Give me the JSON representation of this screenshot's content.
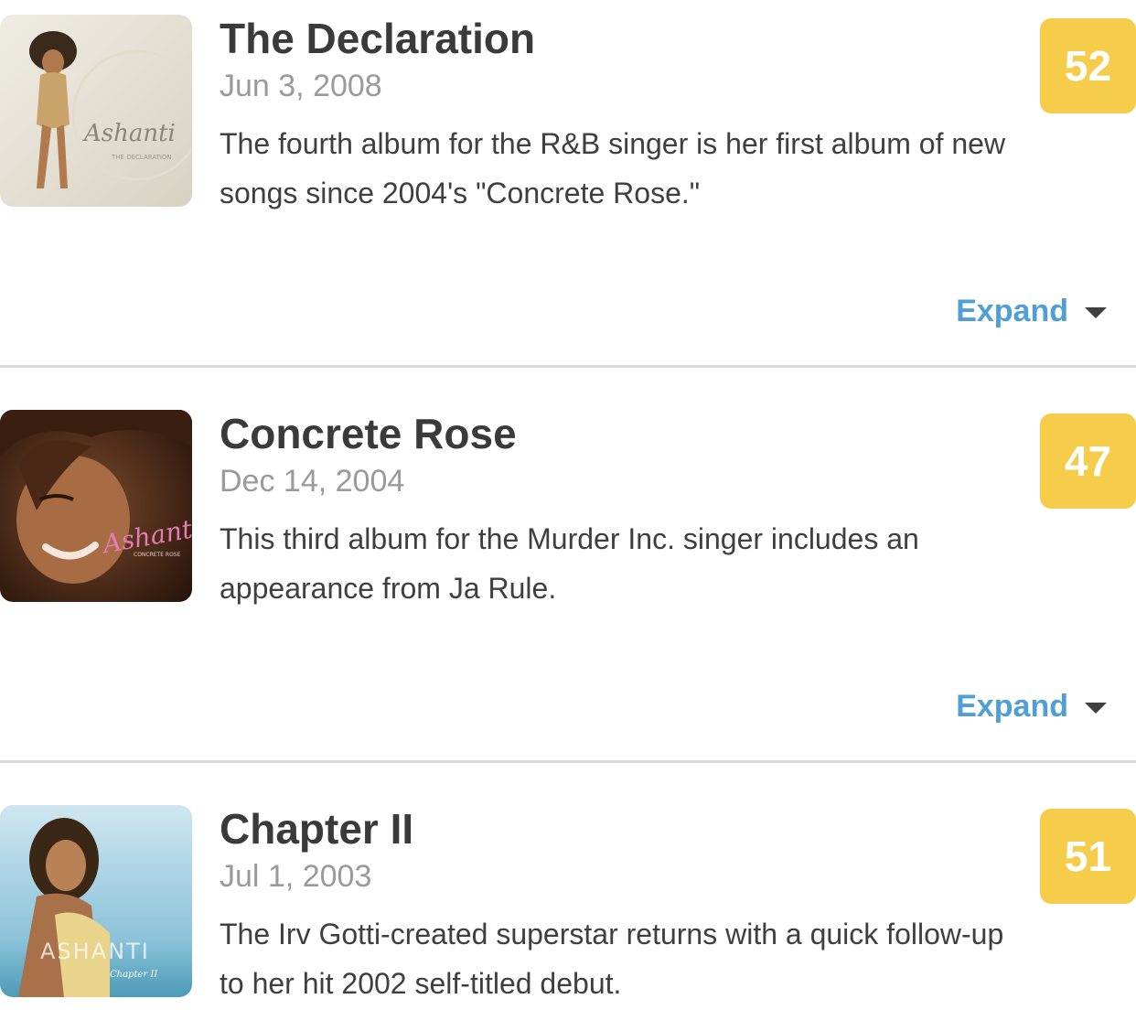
{
  "albums": [
    {
      "title": "The Declaration",
      "date": "Jun 3, 2008",
      "description": "The fourth album for the R&B singer is her first album of new songs since 2004's \"Concrete Rose.\"",
      "score": "52",
      "expand_label": "Expand",
      "cover_text": "Ashanti",
      "cover_subtext": "THE DECLARATION"
    },
    {
      "title": "Concrete Rose",
      "date": "Dec 14, 2004",
      "description": "This third album for the Murder Inc. singer includes an appearance from Ja Rule.",
      "score": "47",
      "expand_label": "Expand",
      "cover_text": "Ashanti",
      "cover_subtext": "CONCRETE ROSE"
    },
    {
      "title": "Chapter II",
      "date": "Jul 1, 2003",
      "description": "The Irv Gotti-created superstar returns with a quick follow-up to her hit 2002 self-titled debut.",
      "score": "51",
      "cover_text": "ASHANTI",
      "cover_subtext": "Chapter II"
    }
  ],
  "colors": {
    "score_badge": "#f5cd4b",
    "expand_link": "#4f9fd6",
    "title": "#3a3a3a",
    "date": "#9a9a9a"
  }
}
